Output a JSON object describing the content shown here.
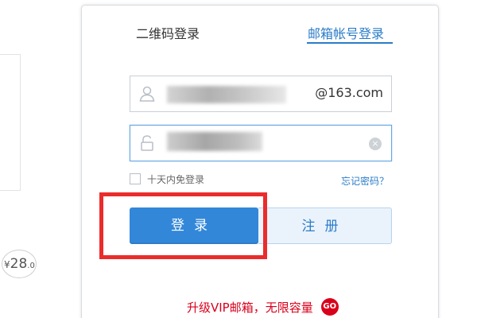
{
  "tabs": {
    "qr_login": "二维码登录",
    "mail_login": "邮箱帐号登录"
  },
  "username": {
    "suffix": "@163.com",
    "icon": "user-icon"
  },
  "password": {
    "icon": "lock-icon",
    "clear": "×"
  },
  "remember": {
    "label": "十天内免登录"
  },
  "forgot": {
    "label": "忘记密码？"
  },
  "buttons": {
    "login": "登录",
    "register": "注册"
  },
  "promo": {
    "text": "升级VIP邮箱，无限容量",
    "go": "GO"
  },
  "price_badge": {
    "currency": "¥",
    "amount": "28",
    "decimal": ".0"
  },
  "colors": {
    "accent": "#2b7cc8",
    "login_button": "#3287d9",
    "promo_red": "#d9001b",
    "annotation_red": "#ea2c2c"
  }
}
